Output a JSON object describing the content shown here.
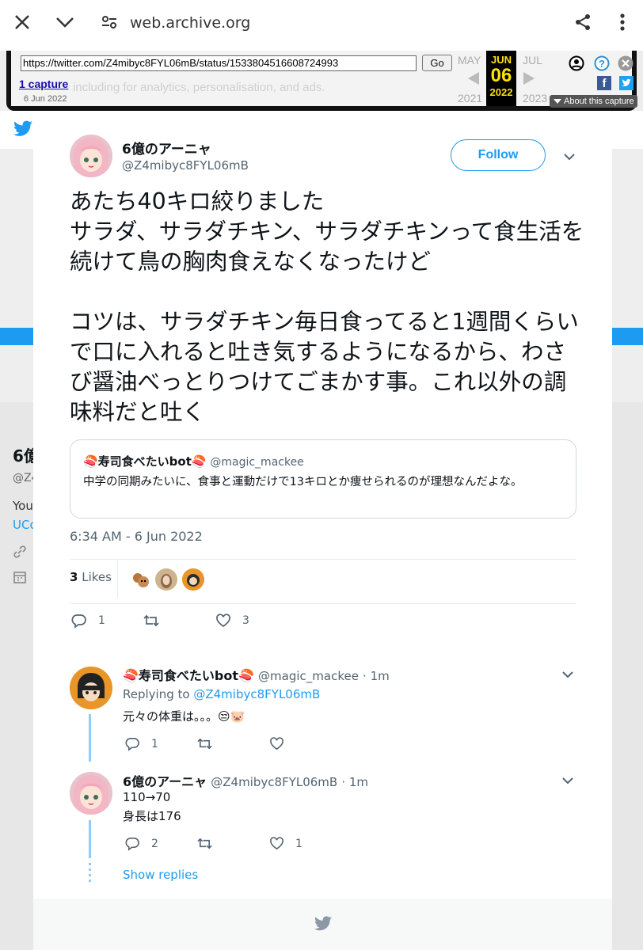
{
  "browser": {
    "url": "web.archive.org"
  },
  "wayback": {
    "url_value": "https://twitter.com/Z4mibyc8FYL06mB/status/1533804516608724993",
    "go_label": "Go",
    "captures_label": "1 capture",
    "capture_date": "6 Jun 2022",
    "prev_month": "MAY",
    "cur_month": "JUN",
    "cur_day": "06",
    "cur_year": "2022",
    "next_month": "JUL",
    "prev_year": "2021",
    "next_year": "2023",
    "about_label": "About this capture",
    "ghost_text": "including for analytics, personalisation, and ads."
  },
  "background": {
    "side_name": "6億",
    "side_handle": "@Z4",
    "side_bio": "You",
    "side_link": "UCc"
  },
  "tweet": {
    "author_name": "6億のアーニャ",
    "author_handle": "@Z4mibyc8FYL06mB",
    "follow_label": "Follow",
    "text": "あたち40キロ絞りました\nサラダ、サラダチキン、サラダチキンって食生活を続けて鳥の胸肉食えなくなったけど\n\nコツは、サラダチキン毎日食ってると1週間くらいで口に入れると吐き気するようになるから、わさび醤油べっとりつけてごまかす事。これ以外の調味料だと吐く",
    "timestamp": "6:34 AM - 6 Jun 2022",
    "likes_count": "3",
    "likes_label": "Likes",
    "reply_count": "1",
    "like_count": "3",
    "quote": {
      "name": "🍣寿司食べたいbot🍣",
      "handle": "@magic_mackee",
      "text": "中学の同期みたいに、食事と運動だけで13キロとか痩せられるのが理想なんだよな。"
    }
  },
  "replies": [
    {
      "name": "🍣寿司食べたいbot🍣",
      "handle": "@magic_mackee",
      "time": "· 1m",
      "replying_prefix": "Replying to",
      "replying_to": "@Z4mibyc8FYL06mB",
      "text": "元々の体重は。。。😒🐷",
      "reply_count": "1",
      "like_count": ""
    },
    {
      "name": "6億のアーニャ",
      "handle": "@Z4mibyc8FYL06mB",
      "time": "· 1m",
      "line1": "110→70",
      "line2": "身長は176",
      "reply_count": "2",
      "like_count": "1"
    }
  ],
  "show_replies_label": "Show replies",
  "colors": {
    "twitter_blue": "#1d9bf0",
    "wayback_yellow": "#ffe100",
    "text_gray": "#536471"
  }
}
